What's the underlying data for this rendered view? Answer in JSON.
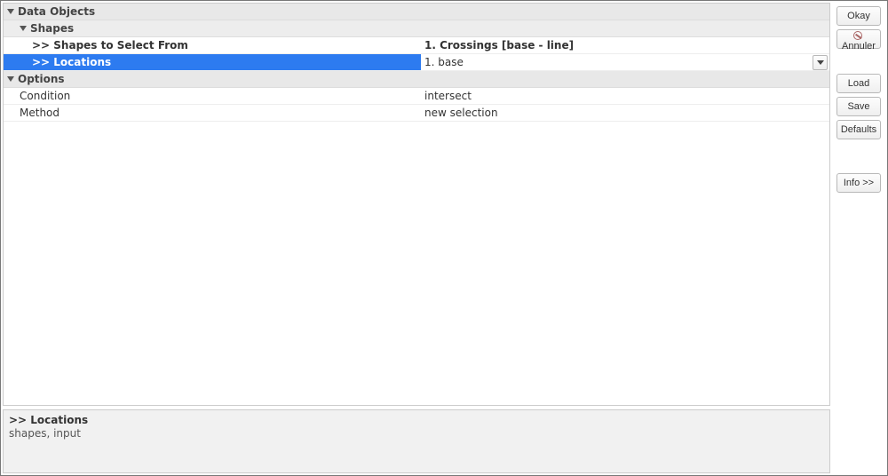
{
  "sections": {
    "data_objects_label": "Data Objects",
    "shapes_label": "Shapes",
    "options_label": "Options"
  },
  "params": {
    "shapes_select_label": ">> Shapes to Select From",
    "shapes_select_value": "1. Crossings [base - line]",
    "locations_label": ">> Locations",
    "locations_value": "1. base"
  },
  "options": {
    "condition_label": "Condition",
    "condition_value": "intersect",
    "method_label": "Method",
    "method_value": "new selection"
  },
  "description": {
    "title": ">> Locations",
    "sub": "shapes, input"
  },
  "buttons": {
    "okay": "Okay",
    "cancel": "Annuler",
    "load": "Load",
    "save": "Save",
    "defaults": "Defaults",
    "info": "Info >>"
  }
}
